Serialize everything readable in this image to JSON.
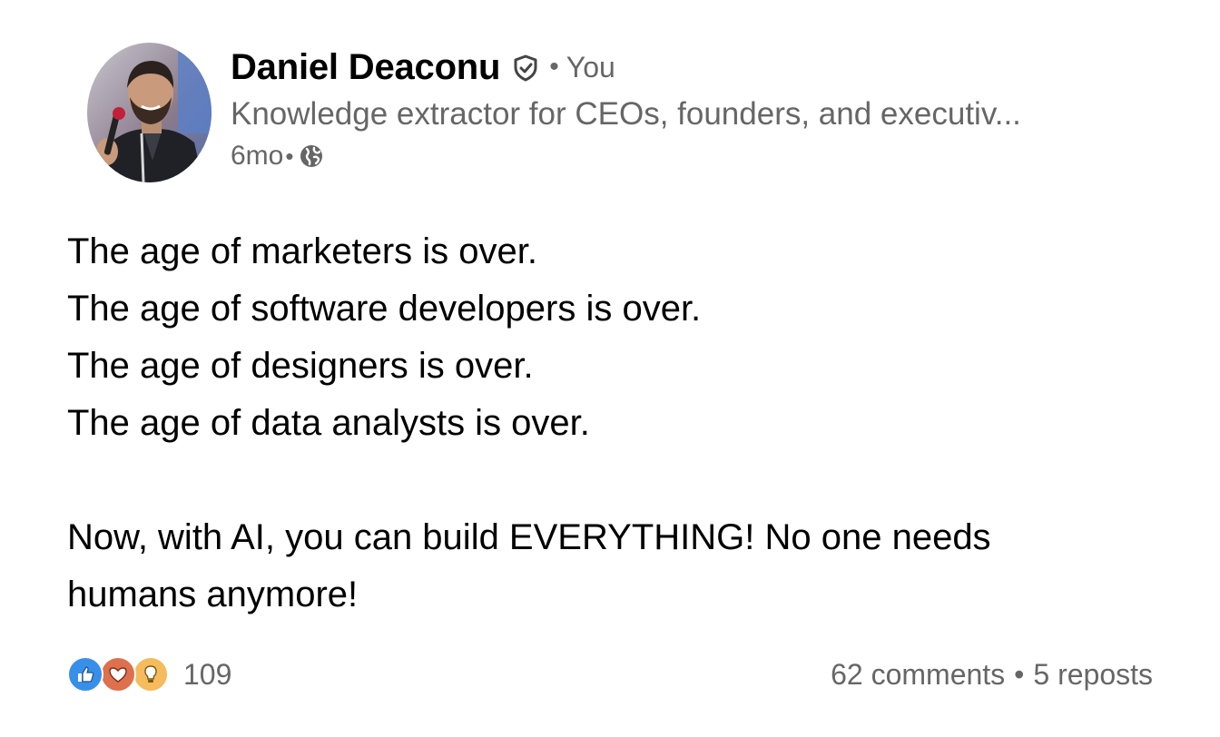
{
  "author": {
    "name": "Daniel Deaconu",
    "separator": "•",
    "degree": "You",
    "headline": "Knowledge extractor for CEOs, founders, and executiv...",
    "avatar_icon": "profile-photo",
    "verified_icon": "verified-shield-icon"
  },
  "meta": {
    "age": "6mo",
    "separator": "•",
    "visibility_icon": "globe-icon"
  },
  "post": {
    "lines": [
      "The age of marketers is over.",
      "The age of software developers is over.",
      "The age of designers is over.",
      "The age of data analysts is over."
    ],
    "paragraph_line_1": "Now, with AI, you can build EVERYTHING! No one needs",
    "paragraph_line_2": "humans anymore!"
  },
  "social": {
    "reaction_icons": [
      "like-icon",
      "love-icon",
      "insightful-icon"
    ],
    "reaction_count": "109",
    "comments": "62 comments",
    "separator": "•",
    "reposts": "5 reposts"
  },
  "colors": {
    "like": "#378fe9",
    "love": "#df704d",
    "insightful": "#f5bb5c",
    "secondary_text": "#666666",
    "primary_text": "#000000"
  }
}
